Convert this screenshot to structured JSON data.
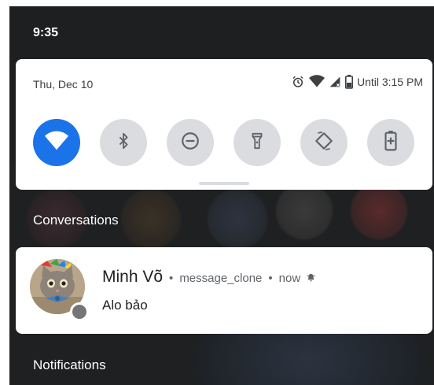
{
  "status_bar": {
    "time": "9:35"
  },
  "quick_settings": {
    "date": "Thu, Dec 10",
    "battery_text": "Until 3:15 PM",
    "tiles": [
      {
        "icon": "wifi-icon",
        "active": true
      },
      {
        "icon": "bluetooth-icon",
        "active": false
      },
      {
        "icon": "do-not-disturb-icon",
        "active": false
      },
      {
        "icon": "flashlight-icon",
        "active": false
      },
      {
        "icon": "auto-rotate-icon",
        "active": false
      },
      {
        "icon": "battery-saver-icon",
        "active": false
      }
    ],
    "colors": {
      "active": "#1a73e8",
      "inactive": "#dadce0"
    }
  },
  "sections": {
    "conversations": "Conversations",
    "notifications": "Notifications"
  },
  "notification": {
    "sender": "Minh Võ",
    "separator": "•",
    "app": "message_clone",
    "time": "now",
    "message": "Alo bảo"
  }
}
